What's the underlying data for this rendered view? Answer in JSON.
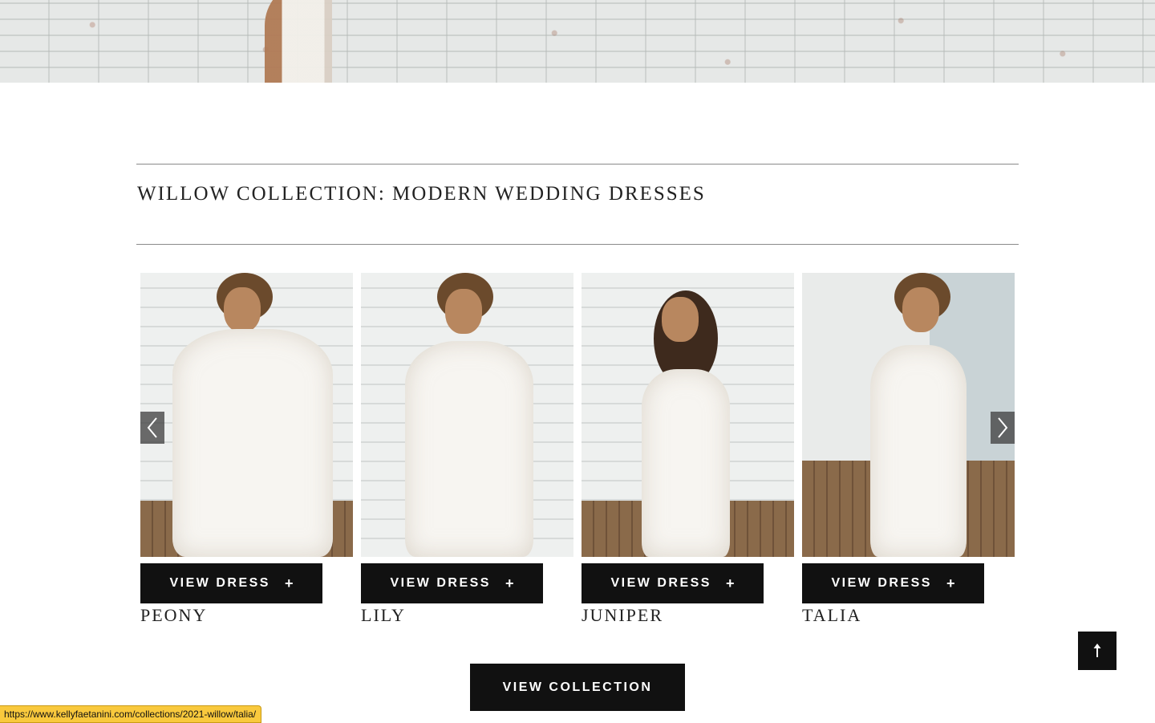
{
  "section": {
    "title": "WILLOW COLLECTION: MODERN WEDDING DRESSES"
  },
  "dresses": [
    {
      "name": "PEONY",
      "button_label": "VIEW DRESS",
      "button_icon": "+"
    },
    {
      "name": "LILY",
      "button_label": "VIEW DRESS",
      "button_icon": "+"
    },
    {
      "name": "JUNIPER",
      "button_label": "VIEW DRESS",
      "button_icon": "+"
    },
    {
      "name": "TALIA",
      "button_label": "VIEW DRESS",
      "button_icon": "+"
    }
  ],
  "carousel": {
    "prev_icon": "chevron-left-icon",
    "next_icon": "chevron-right-icon"
  },
  "view_collection_label": "VIEW COLLECTION",
  "back_to_top_icon": "arrow-up-icon",
  "status_bar": {
    "url": "https://www.kellyfaetanini.com/collections/2021-willow/talia/"
  },
  "colors": {
    "button_background": "#111111",
    "button_text": "#ffffff",
    "status_bar_background": "#f9c93d"
  }
}
